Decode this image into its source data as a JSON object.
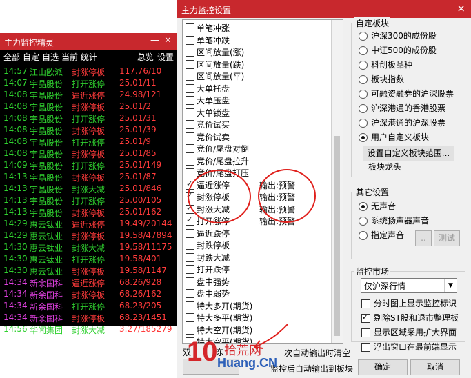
{
  "left_window": {
    "title": "主力监控精灵",
    "controls": [
      "—",
      "×"
    ],
    "menu": [
      "全部",
      "自定",
      "自选",
      "当前",
      "统计",
      "总览",
      "设置"
    ],
    "rows": [
      {
        "time": "14:57",
        "name": "江山欧派",
        "action": "封涨停板",
        "value": "117.76/10",
        "name_color": "#2fd02f",
        "action_color": "#ff3b3b"
      },
      {
        "time": "14:07",
        "name": "宇晶股份",
        "action": "打开涨停",
        "value": "25.01/11",
        "name_color": "#2fd02f",
        "action_color": "#2fd02f"
      },
      {
        "time": "14:08",
        "name": "宇晶股份",
        "action": "逼近涨停",
        "value": "24.98/121",
        "name_color": "#2fd02f",
        "action_color": "#ff3b3b"
      },
      {
        "time": "14:08",
        "name": "宇晶股份",
        "action": "封涨停板",
        "value": "25.01/2",
        "name_color": "#2fd02f",
        "action_color": "#ff3b3b"
      },
      {
        "time": "14:08",
        "name": "宇晶股份",
        "action": "打开涨停",
        "value": "25.01/31",
        "name_color": "#2fd02f",
        "action_color": "#2fd02f"
      },
      {
        "time": "14:08",
        "name": "宇晶股份",
        "action": "封涨停板",
        "value": "25.01/39",
        "name_color": "#2fd02f",
        "action_color": "#ff3b3b"
      },
      {
        "time": "14:08",
        "name": "宇晶股份",
        "action": "打开涨停",
        "value": "25.01/9",
        "name_color": "#2fd02f",
        "action_color": "#2fd02f"
      },
      {
        "time": "14:08",
        "name": "宇晶股份",
        "action": "封涨停板",
        "value": "25.01/85",
        "name_color": "#2fd02f",
        "action_color": "#ff3b3b"
      },
      {
        "time": "14:09",
        "name": "宇晶股份",
        "action": "打开涨停",
        "value": "25.01/149",
        "name_color": "#2fd02f",
        "action_color": "#2fd02f"
      },
      {
        "time": "14:13",
        "name": "宇晶股份",
        "action": "封涨停板",
        "value": "25.01/87",
        "name_color": "#2fd02f",
        "action_color": "#ff3b3b"
      },
      {
        "time": "14:13",
        "name": "宇晶股份",
        "action": "封涨大减",
        "value": "25.01/846",
        "name_color": "#2fd02f",
        "action_color": "#2fd02f"
      },
      {
        "time": "14:13",
        "name": "宇晶股份",
        "action": "打开涨停",
        "value": "25.00/105",
        "name_color": "#2fd02f",
        "action_color": "#2fd02f"
      },
      {
        "time": "14:13",
        "name": "宇晶股份",
        "action": "封涨停板",
        "value": "25.01/162",
        "name_color": "#2fd02f",
        "action_color": "#ff3b3b"
      },
      {
        "time": "14:29",
        "name": "惠云钛业",
        "action": "逼近涨停",
        "value": "19.49/20144",
        "name_color": "#2fd02f",
        "action_color": "#ff3b3b"
      },
      {
        "time": "14:29",
        "name": "惠云钛业",
        "action": "封涨停板",
        "value": "19.58/47894",
        "name_color": "#2fd02f",
        "action_color": "#ff3b3b"
      },
      {
        "time": "14:30",
        "name": "惠云钛业",
        "action": "封涨大减",
        "value": "19.58/11175",
        "name_color": "#2fd02f",
        "action_color": "#2fd02f"
      },
      {
        "time": "14:30",
        "name": "惠云钛业",
        "action": "打开涨停",
        "value": "19.58/401",
        "name_color": "#2fd02f",
        "action_color": "#2fd02f"
      },
      {
        "time": "14:30",
        "name": "惠云钛业",
        "action": "封涨停板",
        "value": "19.58/1147",
        "name_color": "#2fd02f",
        "action_color": "#ff3b3b"
      },
      {
        "time": "14:34",
        "name": "新余国科",
        "action": "逼近涨停",
        "value": "68.26/928",
        "name_color": "#e040e0",
        "action_color": "#ff3b3b"
      },
      {
        "time": "14:34",
        "name": "新余国科",
        "action": "封涨停板",
        "value": "68.26/162",
        "name_color": "#e040e0",
        "action_color": "#ff3b3b"
      },
      {
        "time": "14:34",
        "name": "新余国科",
        "action": "打开涨停",
        "value": "68.23/205",
        "name_color": "#e040e0",
        "action_color": "#2fd02f"
      },
      {
        "time": "14:34",
        "name": "新余国科",
        "action": "封涨停板",
        "value": "68.23/1451",
        "name_color": "#e040e0",
        "action_color": "#ff3b3b"
      },
      {
        "time": "14:56",
        "name": "华闻集团",
        "action": "封涨大减",
        "value": "3.27/185279",
        "name_color": "#2fd02f",
        "action_color": "#2fd02f"
      }
    ]
  },
  "dialog": {
    "title": "主力监控设置",
    "close": "×",
    "options": [
      {
        "label": "单笔冲涨",
        "checked": false,
        "output": ""
      },
      {
        "label": "单笔冲跌",
        "checked": false,
        "output": ""
      },
      {
        "label": "区间放量(涨)",
        "checked": false,
        "output": ""
      },
      {
        "label": "区间放量(跌)",
        "checked": false,
        "output": ""
      },
      {
        "label": "区间放量(平)",
        "checked": false,
        "output": ""
      },
      {
        "label": "大单托盘",
        "checked": false,
        "output": ""
      },
      {
        "label": "大单压盘",
        "checked": false,
        "output": ""
      },
      {
        "label": "大单锁盘",
        "checked": false,
        "output": ""
      },
      {
        "label": "竞价试买",
        "checked": false,
        "output": ""
      },
      {
        "label": "竞价试卖",
        "checked": false,
        "output": ""
      },
      {
        "label": "竞价/尾盘对倒",
        "checked": false,
        "output": ""
      },
      {
        "label": "竞价/尾盘拉升",
        "checked": false,
        "output": ""
      },
      {
        "label": "竞价/尾盘打压",
        "checked": false,
        "output": ""
      },
      {
        "label": "逼近涨停",
        "checked": true,
        "output": "输出:预警"
      },
      {
        "label": "封涨停板",
        "checked": true,
        "output": "输出:预警"
      },
      {
        "label": "封涨大减",
        "checked": true,
        "output": "输出:预警"
      },
      {
        "label": "打开涨停",
        "checked": true,
        "output": "输出:预警"
      },
      {
        "label": "逼近跌停",
        "checked": false,
        "output": ""
      },
      {
        "label": "封跌停板",
        "checked": false,
        "output": ""
      },
      {
        "label": "封跌大减",
        "checked": false,
        "output": ""
      },
      {
        "label": "打开跌停",
        "checked": false,
        "output": ""
      },
      {
        "label": "盘中强势",
        "checked": false,
        "output": ""
      },
      {
        "label": "盘中弱势",
        "checked": false,
        "output": ""
      },
      {
        "label": "特大多开(期货)",
        "checked": false,
        "output": ""
      },
      {
        "label": "特大多平(期货)",
        "checked": false,
        "output": ""
      },
      {
        "label": "特大空开(期货)",
        "checked": false,
        "output": ""
      },
      {
        "label": "特大空平(期货)",
        "checked": false,
        "output": ""
      }
    ],
    "bottom_left_partial": "双",
    "bottom_left_partial2": "东",
    "bottom_mid_text": "次自动输出时清空",
    "bottom_mid_text2": "监控后自动输出到板块",
    "custom_block": {
      "title": "自定板块",
      "radios": [
        {
          "label": "沪深300的成份股",
          "selected": false
        },
        {
          "label": "中证500的成份股",
          "selected": false
        },
        {
          "label": "科创板品种",
          "selected": false
        },
        {
          "label": "板块指数",
          "selected": false
        },
        {
          "label": "可融资融券的沪深股票",
          "selected": false
        },
        {
          "label": "沪深港通的香港股票",
          "selected": false
        },
        {
          "label": "沪深港通的沪深股票",
          "selected": false
        },
        {
          "label": "用户自定义板块",
          "selected": true
        }
      ],
      "range_button": "设置自定义板块范围...",
      "block_name": "板块龙头"
    },
    "other": {
      "title": "其它设置",
      "radios": [
        {
          "label": "无声音",
          "selected": true
        },
        {
          "label": "系统扬声器声音",
          "selected": false
        },
        {
          "label": "指定声音",
          "selected": false
        }
      ],
      "browse": "..",
      "test": "测试"
    },
    "market": {
      "title": "监控市场",
      "value": "仅沪深行情",
      "arrow": "▼"
    },
    "checks": [
      {
        "label": "分时图上显示监控标识",
        "checked": false
      },
      {
        "label": "剔除ST股和退市整理板",
        "checked": true
      },
      {
        "label": "显示区域采用扩大界面",
        "checked": false
      },
      {
        "label": "浮出窗口在最前端显示",
        "checked": false
      }
    ],
    "ok": "确定",
    "cancel": "取消"
  },
  "watermark": {
    "big": "10",
    "site": "拾荒网",
    "url": "Huang.CN"
  }
}
